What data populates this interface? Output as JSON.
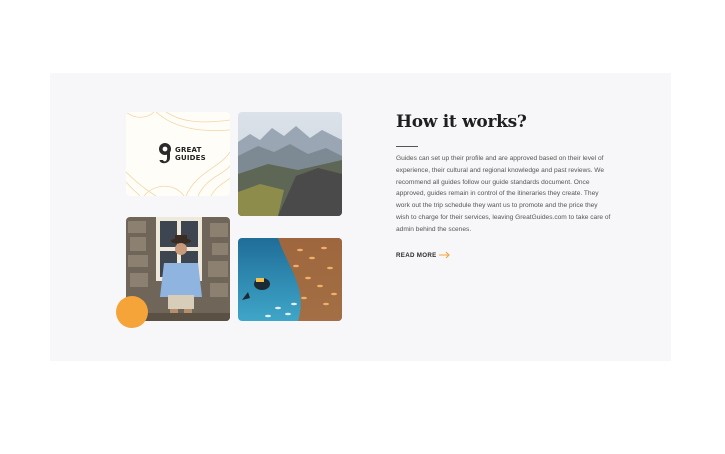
{
  "section": {
    "title": "How it works?",
    "body": "Guides can set up their profile and are approved based on their level of experience, their cultural and regional knowledge and past reviews. We recommend all guides follow our guide standards document. Once approved, guides remain in control of the itineraries they create. They work out the trip schedule they want us to promote and the price they wish to charge for their services, leaving GreatGuides.com to take care of admin behind the scenes.",
    "read_more_label": "READ MORE"
  },
  "logo": {
    "line1": "GREAT",
    "line2": "GUIDES"
  },
  "colors": {
    "accent": "#f5a43a",
    "panel_bg": "#f7f7f9",
    "heading": "#1f1f1f",
    "body_text": "#555555"
  },
  "icons": {
    "read_more": "arrow-right-icon",
    "logo_mark": "g-logo-icon"
  }
}
